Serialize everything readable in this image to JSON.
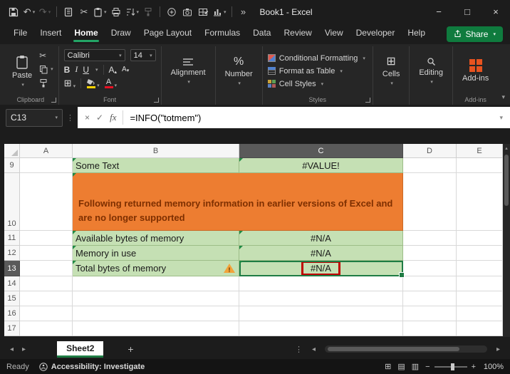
{
  "window": {
    "title": "Book1 - Excel"
  },
  "icons": {
    "dropdown": "▾",
    "up": "▴",
    "undo": "↶",
    "redo": "↷",
    "cut": "✂",
    "overflow": "»",
    "minimize": "−",
    "maximize": "□",
    "close": "×",
    "cancel": "×",
    "check": "✓",
    "fx": "fx",
    "dots": "⋮",
    "tab_prev": "◂",
    "tab_next": "▸",
    "scroll_left": "◂",
    "scroll_right": "▸",
    "scroll_up": "▴",
    "add": "+",
    "zoom_out": "−",
    "zoom_in": "+",
    "view_grid": "⊞",
    "view_layout": "▤",
    "view_break": "▥",
    "borders": "⊞",
    "percent": "%"
  },
  "ribbon_tabs": {
    "items": [
      "File",
      "Insert",
      "Home",
      "Draw",
      "Page Layout",
      "Formulas",
      "Data",
      "Review",
      "View",
      "Developer",
      "Help"
    ],
    "share": "Share"
  },
  "ribbon": {
    "clipboard": {
      "paste": "Paste",
      "label": "Clipboard"
    },
    "font": {
      "name": "Calibri",
      "size": "14",
      "bold": "B",
      "italic": "I",
      "underline": "U",
      "a": "A",
      "label": "Font"
    },
    "alignment": {
      "label": "Alignment"
    },
    "number": {
      "label": "Number"
    },
    "styles": {
      "conditional": "Conditional Formatting",
      "table": "Format as Table",
      "cellstyles": "Cell Styles",
      "label": "Styles"
    },
    "cells": {
      "label": "Cells"
    },
    "editing": {
      "label": "Editing"
    },
    "addins": {
      "label": "Add-ins",
      "group_label": "Add-ins"
    }
  },
  "formula_bar": {
    "name_box": "C13",
    "formula": "=INFO(\"totmem\")"
  },
  "grid": {
    "columns": [
      "A",
      "B",
      "C",
      "D",
      "E"
    ],
    "rows": [
      "9",
      "10",
      "11",
      "12",
      "13",
      "14",
      "15",
      "16",
      "17"
    ],
    "cells": {
      "b9": "Some Text",
      "c9": "#VALUE!",
      "b10": "Following returned memory information in earlier versions of Excel and are no longer supported",
      "b11": "Available bytes of memory",
      "c11": "#N/A",
      "b12": "Memory in use",
      "c12": "#N/A",
      "b13": "Total bytes of memory",
      "c13": "#N/A"
    }
  },
  "sheet_bar": {
    "active_tab": "Sheet2"
  },
  "status_bar": {
    "mode": "Ready",
    "accessibility": "Accessibility: Investigate",
    "zoom": "100%"
  }
}
